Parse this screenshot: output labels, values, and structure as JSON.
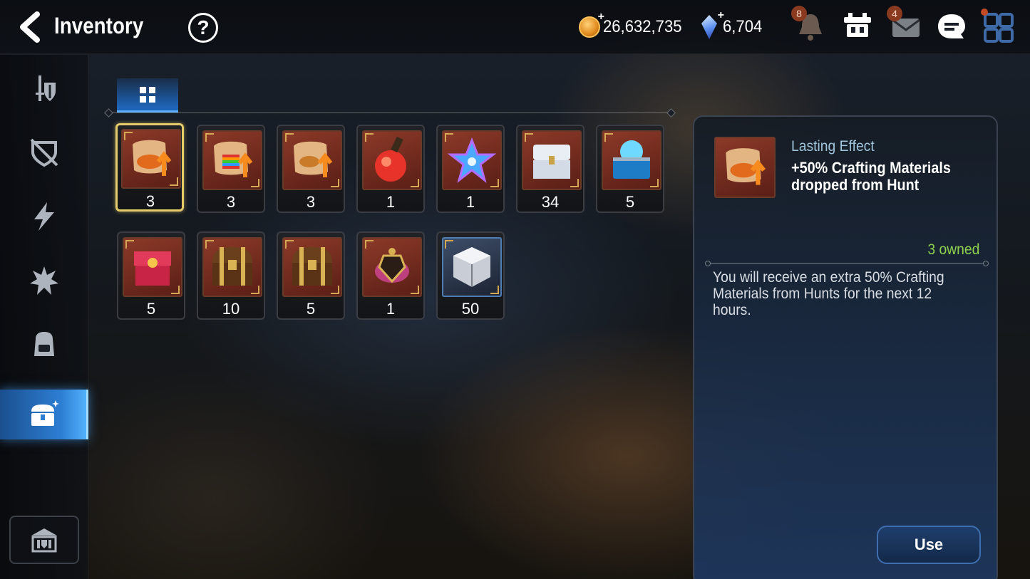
{
  "header": {
    "title": "Inventory",
    "help_label": "?",
    "gold": "26,632,735",
    "crystals": "6,704",
    "notifications_badge": "8",
    "mail_badge": "4"
  },
  "tabs": [
    {
      "label": "",
      "icon": "grid-icon",
      "active": true
    }
  ],
  "sidebar": {
    "items": [
      {
        "icon": "sword-shield-icon",
        "active": false
      },
      {
        "icon": "broken-shield-icon",
        "active": false
      },
      {
        "icon": "lightning-icon",
        "active": false
      },
      {
        "icon": "spiky-burst-icon",
        "active": false
      },
      {
        "icon": "backpack-icon",
        "active": false
      },
      {
        "icon": "treasure-chest-icon",
        "active": true
      }
    ],
    "bottom_icon": "guild-hall-icon"
  },
  "items": [
    {
      "name": "scroll-orange",
      "count": "3",
      "selected": true
    },
    {
      "name": "scroll-rainbow",
      "count": "3"
    },
    {
      "name": "scroll-gold",
      "count": "3"
    },
    {
      "name": "red-potion",
      "count": "1"
    },
    {
      "name": "star-potion",
      "count": "1"
    },
    {
      "name": "silver-chest",
      "count": "34"
    },
    {
      "name": "blue-orb-chest",
      "count": "5"
    },
    {
      "name": "red-gift-box",
      "count": "5"
    },
    {
      "name": "wooden-chest",
      "count": "10"
    },
    {
      "name": "wooden-chest",
      "count": "5"
    },
    {
      "name": "magic-lamp",
      "count": "1"
    },
    {
      "name": "silver-cube",
      "count": "50"
    }
  ],
  "detail": {
    "category": "Lasting Effect",
    "title": "+50% Crafting Materials dropped from Hunt",
    "owned": "3 owned",
    "description": "You will receive an extra 50% Crafting Materials from Hunts for the next 12 hours.",
    "use_label": "Use"
  },
  "colors": {
    "accent": "#2d7fd4",
    "selected_border": "#e6cb6a",
    "owned_text": "#8fd14f"
  }
}
